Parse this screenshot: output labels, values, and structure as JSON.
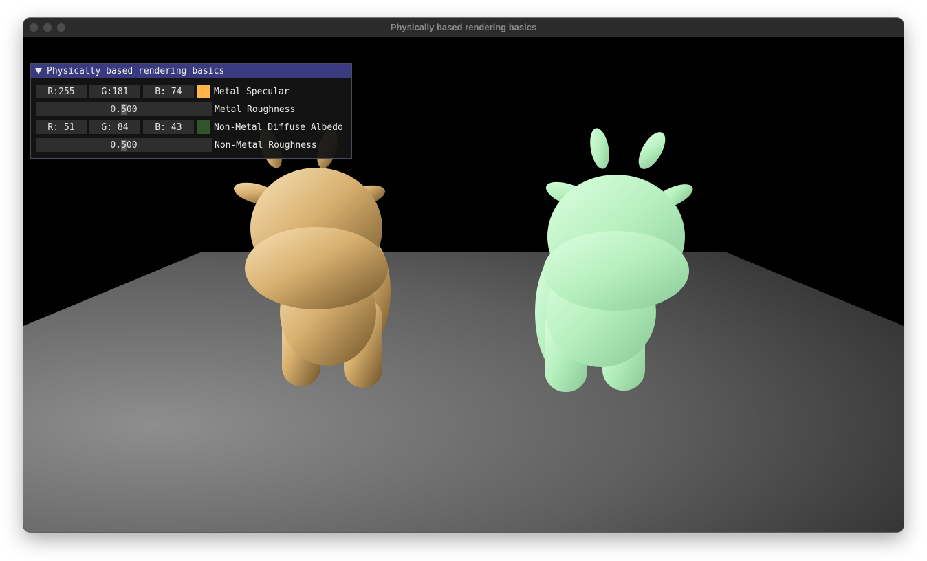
{
  "window": {
    "title": "Physically based rendering basics"
  },
  "panel": {
    "title": "Physically based rendering basics",
    "metal_specular": {
      "r": "R:255",
      "g": "G:181",
      "b": "B: 74",
      "color": "#ffb54a",
      "label": "Metal Specular"
    },
    "metal_roughness": {
      "value": "0.500",
      "fraction": 0.5,
      "label": "Metal Roughness"
    },
    "nonmetal_albedo": {
      "r": "R: 51",
      "g": "G: 84",
      "b": "B: 43",
      "color": "#33542b",
      "label": "Non-Metal Diffuse Albedo"
    },
    "nonmetal_roughness": {
      "value": "0.500",
      "fraction": 0.5,
      "label": "Non-Metal Roughness"
    }
  },
  "colors": {
    "metal_cow": "#e8c98a",
    "nonmetal_cow": "#b8f0c0",
    "floor": "#6a6a6a"
  }
}
